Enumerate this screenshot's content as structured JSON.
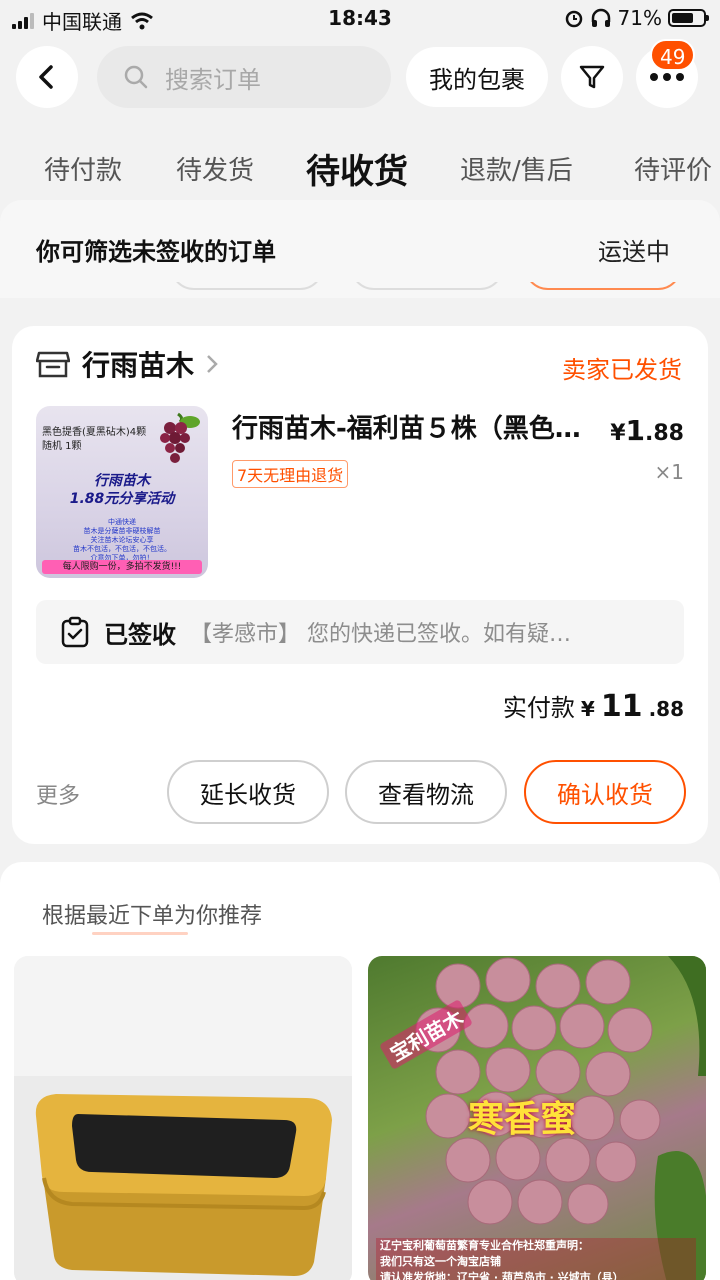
{
  "status_bar": {
    "carrier": "中国联通",
    "time": "18:43",
    "battery": "71%"
  },
  "header": {
    "search_placeholder": "搜索订单",
    "my_packages": "我的包裹",
    "badge_count": "49"
  },
  "tabs": [
    {
      "label": "待付款",
      "active": false
    },
    {
      "label": "待发货",
      "active": false
    },
    {
      "label": "待收货",
      "active": true
    },
    {
      "label": "退款/售后",
      "active": false
    },
    {
      "label": "待评价",
      "active": false
    }
  ],
  "filter": {
    "hint": "你可筛选未签收的订单",
    "state": "运送中"
  },
  "order": {
    "shop_name": "行雨苗木",
    "shop_status": "卖家已发货",
    "product_title": "行雨苗木-福利苗５株（黑色…",
    "price_currency": "¥",
    "price_int": "1",
    "price_dec": ".88",
    "tag": "7天无理由退货",
    "quantity": "×1",
    "thumb_line1": "黑色提香(夏黑砧木)4颗",
    "thumb_line2": "随机 1颗",
    "thumb_promo_1": "行雨苗木",
    "thumb_promo_2": "1.88元分享活动",
    "thumb_small_1": "中通快递",
    "thumb_small_2": "苗木是分蘖苗非硬枝解苗",
    "thumb_small_3": "关注苗木论坛安心享",
    "thumb_small_4": "苗木不包活，不包活，不包活。",
    "thumb_small_5": "介意勿下单，勿拍！",
    "thumb_bottom": "每人限购一份，多拍不发货!!!",
    "logistics_status": "已签收",
    "logistics_msg": "【孝感市】 您的快递已签收。如有疑…",
    "paid_label": "实付款",
    "paid_currency": "¥",
    "paid_int": "11",
    "paid_dec": ".88",
    "more": "更多",
    "btn_extend": "延长收货",
    "btn_logistics": "查看物流",
    "btn_confirm": "确认收货"
  },
  "recommend": {
    "title": "根据最近下单为你推荐",
    "items": [
      {
        "image": "gold-tin-box"
      },
      {
        "image": "grape",
        "brand": "宝利苗木",
        "label": "寒香蜜",
        "note_1": "辽宁宝利葡萄苗繁育专业合作社郑重声明：",
        "note_2": "我们只有这一个淘宝店铺",
        "note_3": "请认准发货地：辽宁省 · 葫芦岛市 · 兴城市（县）"
      }
    ]
  },
  "colors": {
    "accent": "#ff5000",
    "background": "#f2f2f2"
  }
}
